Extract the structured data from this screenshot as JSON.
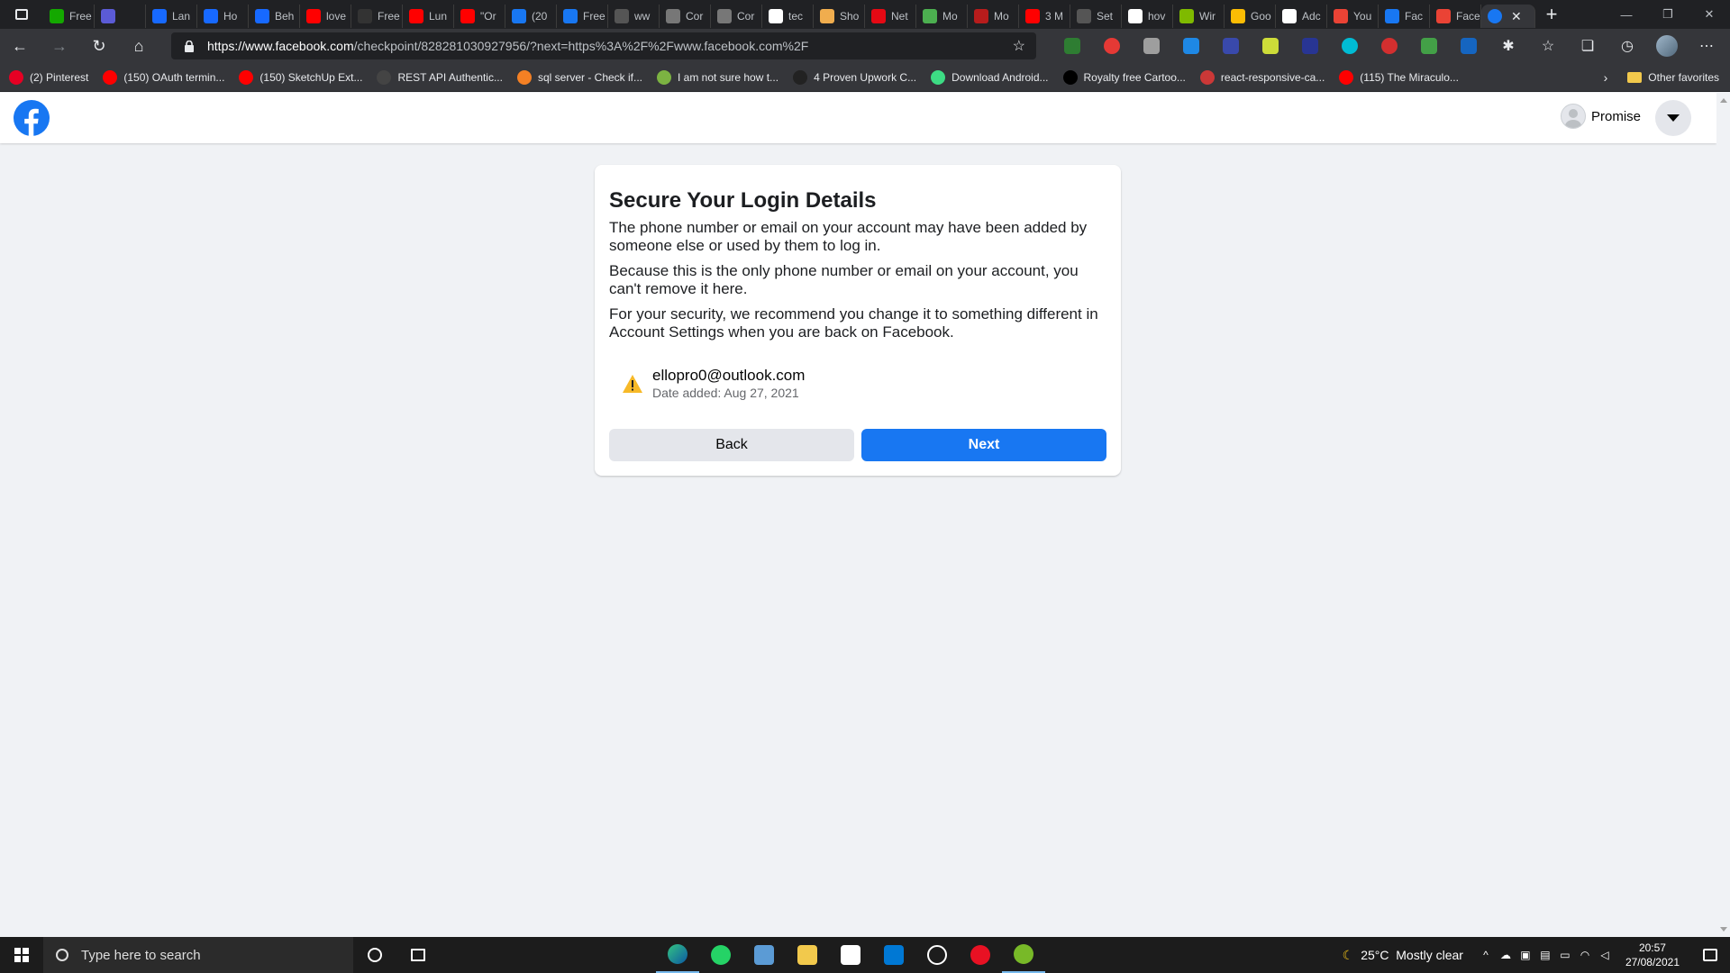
{
  "browser": {
    "tabs": [
      {
        "label": "Free",
        "color": "#14a800"
      },
      {
        "label": "",
        "color": "#5b5bd6"
      },
      {
        "label": "Lan",
        "color": "#1769ff"
      },
      {
        "label": "Ho",
        "color": "#1769ff"
      },
      {
        "label": "Beh",
        "color": "#1769ff"
      },
      {
        "label": "love",
        "color": "#ff0000"
      },
      {
        "label": "Free",
        "color": "#333333"
      },
      {
        "label": "Lun",
        "color": "#ff0000"
      },
      {
        "label": "\"Or",
        "color": "#ff0000"
      },
      {
        "label": "(20",
        "color": "#1877f2"
      },
      {
        "label": "Free",
        "color": "#1877f2"
      },
      {
        "label": "ww",
        "color": "#555555"
      },
      {
        "label": "Cor",
        "color": "#777777"
      },
      {
        "label": "Cor",
        "color": "#777777"
      },
      {
        "label": "tec",
        "color": "#ffffff"
      },
      {
        "label": "Sho",
        "color": "#f0ad4e"
      },
      {
        "label": "Net",
        "color": "#e50914"
      },
      {
        "label": "Mo",
        "color": "#4caf50"
      },
      {
        "label": "Mo",
        "color": "#b71c1c"
      },
      {
        "label": "3 M",
        "color": "#ff0000"
      },
      {
        "label": "Set",
        "color": "#555555"
      },
      {
        "label": "hov",
        "color": "#ffffff"
      },
      {
        "label": "Wir",
        "color": "#7fba00"
      },
      {
        "label": "Goo",
        "color": "#fbbc04"
      },
      {
        "label": "Adc",
        "color": "#ffffff"
      },
      {
        "label": "You",
        "color": "#ea4335"
      },
      {
        "label": "Fac",
        "color": "#1877f2"
      },
      {
        "label": "Face",
        "color": "#ea4335"
      }
    ],
    "active_tab_close": "✕",
    "new_tab": "+",
    "url_host": "https://www.facebook.com",
    "url_path": "/checkpoint/828281030927956/?next=https%3A%2F%2Fwww.facebook.com%2F",
    "bookmarks": [
      {
        "label": "(2) Pinterest",
        "color": "#e60023"
      },
      {
        "label": "(150) OAuth termin...",
        "color": "#ff0000"
      },
      {
        "label": "(150) SketchUp Ext...",
        "color": "#ff0000"
      },
      {
        "label": "REST API Authentic...",
        "color": "#444444"
      },
      {
        "label": "sql server - Check if...",
        "color": "#f48024"
      },
      {
        "label": "I am not sure how t...",
        "color": "#7cb342"
      },
      {
        "label": "4 Proven Upwork C...",
        "color": "#222222"
      },
      {
        "label": "Download Android...",
        "color": "#3ddc84"
      },
      {
        "label": "Royalty free Cartoo...",
        "color": "#000000"
      },
      {
        "label": "react-responsive-ca...",
        "color": "#cb3837"
      },
      {
        "label": "(115) The Miraculo...",
        "color": "#ff0000"
      }
    ],
    "other_favorites": "Other favorites"
  },
  "fb": {
    "profile_name": "Promise",
    "title": "Secure Your Login Details",
    "p1": "The phone number or email on your account may have been added by someone else or used by them to log in.",
    "p2": "Because this is the only phone number or email on your account, you can't remove it here.",
    "p3": "For your security, we recommend you change it to something different in Account Settings when you are back on Facebook.",
    "email": "ellopro0@outlook.com",
    "date_added": "Date added: Aug 27, 2021",
    "back_label": "Back",
    "next_label": "Next",
    "brand_color": "#1877f2"
  },
  "taskbar": {
    "search_placeholder": "Type here to search",
    "weather": "25°C  Mostly clear",
    "time": "20:57",
    "date": "27/08/2021"
  }
}
